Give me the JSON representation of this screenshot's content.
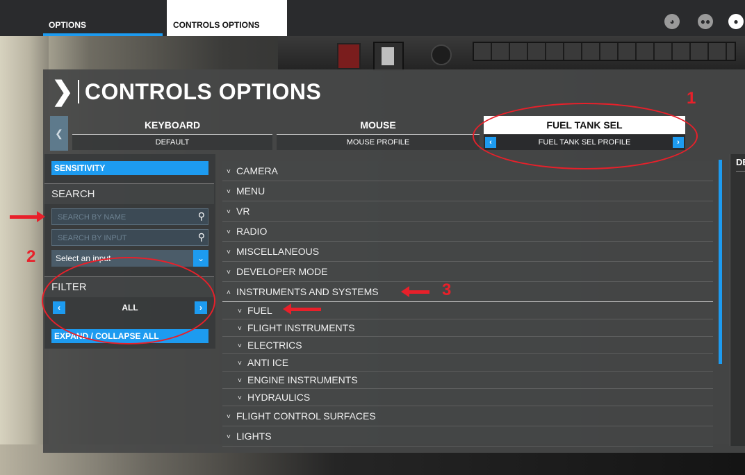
{
  "top_bar": {
    "tab_options": "OPTIONS",
    "tab_controls_options": "CONTROLS OPTIONS",
    "icons": [
      "activity-icon",
      "friends-icon",
      "profile-icon"
    ]
  },
  "page_title": "CONTROLS OPTIONS",
  "profile_tabs": [
    {
      "name": "KEYBOARD",
      "profile": "DEFAULT"
    },
    {
      "name": "MOUSE",
      "profile": "MOUSE PROFILE"
    },
    {
      "name": "FUEL TANK SEL",
      "profile": "FUEL TANK SEL PROFILE"
    }
  ],
  "left_panel": {
    "sensitivity_label": "SENSITIVITY",
    "search_heading": "SEARCH",
    "search_by_name_placeholder": "SEARCH BY NAME",
    "search_by_input_placeholder": "SEARCH BY INPUT",
    "select_input_value": "Select an input",
    "filter_heading": "FILTER",
    "filter_value": "ALL",
    "expand_collapse_label": "EXPAND / COLLAPSE ALL"
  },
  "categories": [
    {
      "label": "CAMERA",
      "level": 0,
      "expanded": false
    },
    {
      "label": "MENU",
      "level": 0,
      "expanded": false
    },
    {
      "label": "VR",
      "level": 0,
      "expanded": false
    },
    {
      "label": "RADIO",
      "level": 0,
      "expanded": false
    },
    {
      "label": "MISCELLANEOUS",
      "level": 0,
      "expanded": false
    },
    {
      "label": "DEVELOPER MODE",
      "level": 0,
      "expanded": false
    },
    {
      "label": "INSTRUMENTS AND SYSTEMS",
      "level": 0,
      "expanded": true
    },
    {
      "label": "FUEL",
      "level": 1,
      "expanded": false
    },
    {
      "label": "FLIGHT INSTRUMENTS",
      "level": 1,
      "expanded": false
    },
    {
      "label": "ELECTRICS",
      "level": 1,
      "expanded": false
    },
    {
      "label": "ANTI ICE",
      "level": 1,
      "expanded": false
    },
    {
      "label": "ENGINE INSTRUMENTS",
      "level": 1,
      "expanded": false
    },
    {
      "label": "HYDRAULICS",
      "level": 1,
      "expanded": false
    },
    {
      "label": "FLIGHT CONTROL SURFACES",
      "level": 0,
      "expanded": false
    },
    {
      "label": "LIGHTS",
      "level": 0,
      "expanded": false
    }
  ],
  "right_panel_fragment": "DE",
  "annotations": {
    "n1": "1",
    "n2": "2",
    "n3": "3"
  },
  "colors": {
    "accent": "#1d9bf0",
    "annotation": "#e8202a"
  }
}
